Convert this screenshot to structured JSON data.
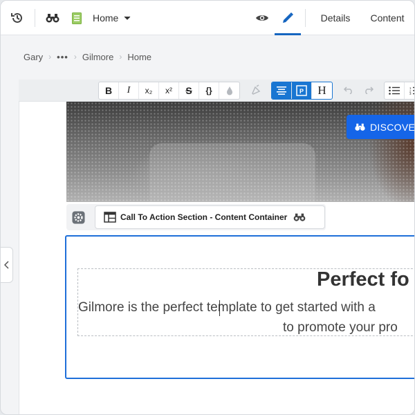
{
  "topbar": {
    "home_label": "Home",
    "details_tab": "Details",
    "content_tab": "Content"
  },
  "breadcrumb": {
    "items": [
      "Gary",
      "•••",
      "Gilmore",
      "Home"
    ]
  },
  "toolbar": {
    "bold": "B",
    "italic": "I",
    "subscript": "x₂",
    "superscript": "x²",
    "strike": "S",
    "code": "{}",
    "heading": "H"
  },
  "hero": {
    "discover_label": "DISCOVE"
  },
  "section": {
    "label": "Call To Action Section - Content Container"
  },
  "content": {
    "headline": "Perfect fo",
    "line1": "Gilmore is the perfect template to get started with a",
    "line2": "to promote your pro"
  },
  "colors": {
    "accent": "#1565c0",
    "active_button": "#1976d2",
    "discover_button": "#1565e8",
    "selection_border": "#1e6fd9"
  }
}
